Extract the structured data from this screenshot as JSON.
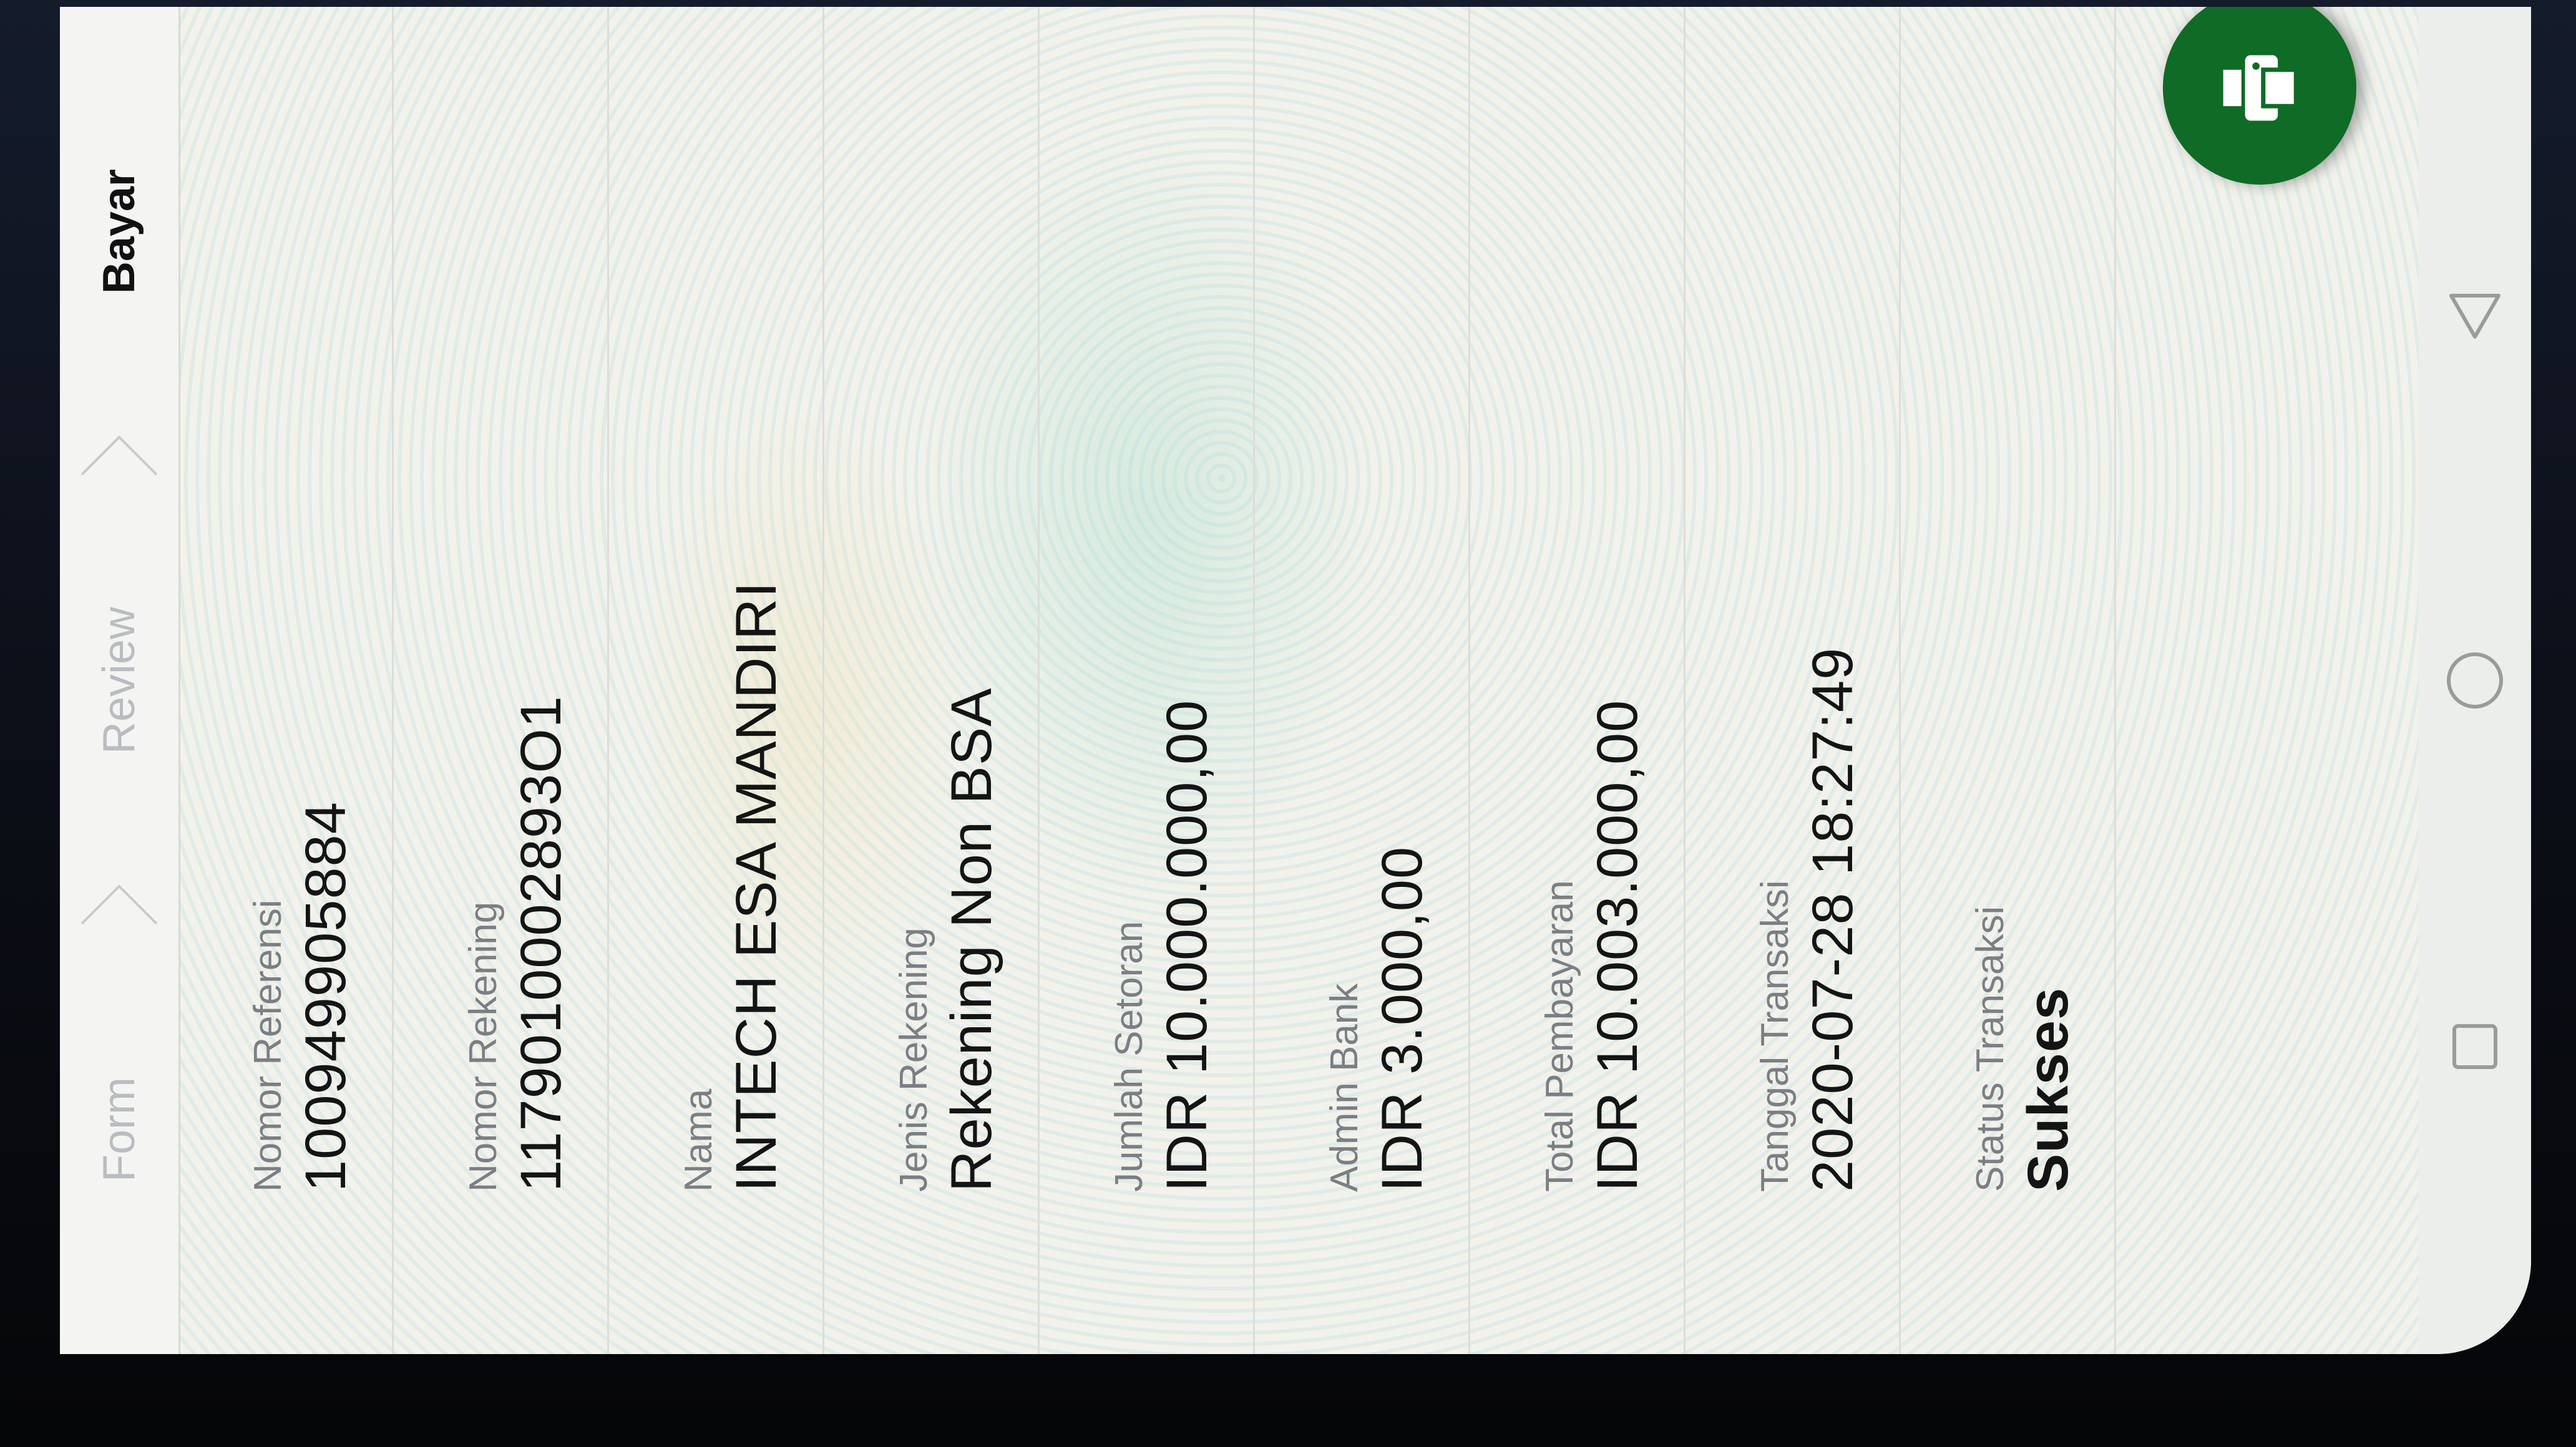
{
  "stepper": {
    "steps": [
      {
        "label": "Form"
      },
      {
        "label": "Review"
      },
      {
        "label": "Bayar"
      }
    ],
    "active": "Bayar"
  },
  "details": [
    {
      "label": "Nomor Referensi",
      "value": "100949905884"
    },
    {
      "label": "Nomor Rekening",
      "value": "1179010002893O1"
    },
    {
      "label": "Nama",
      "value": "INTECH ESA MANDIRI"
    },
    {
      "label": "Jenis Rekening",
      "value": "Rekening Non BSA"
    },
    {
      "label": "Jumlah Setoran",
      "value": "IDR 10.000.000,00"
    },
    {
      "label": "Admin Bank",
      "value": "IDR 3.000,00"
    },
    {
      "label": "Total Pembayaran",
      "value": "IDR 10.003.000,00"
    },
    {
      "label": "Tanggal Transaksi",
      "value": "2020-07-28 18:27:49"
    },
    {
      "label": "Status Transaksi",
      "value": "Sukses"
    }
  ],
  "fab": {
    "icon": "printer-icon",
    "color": "#0f6b25"
  },
  "navbar": {
    "icons": [
      "recents-square-icon",
      "home-circle-icon",
      "back-triangle-icon"
    ]
  }
}
